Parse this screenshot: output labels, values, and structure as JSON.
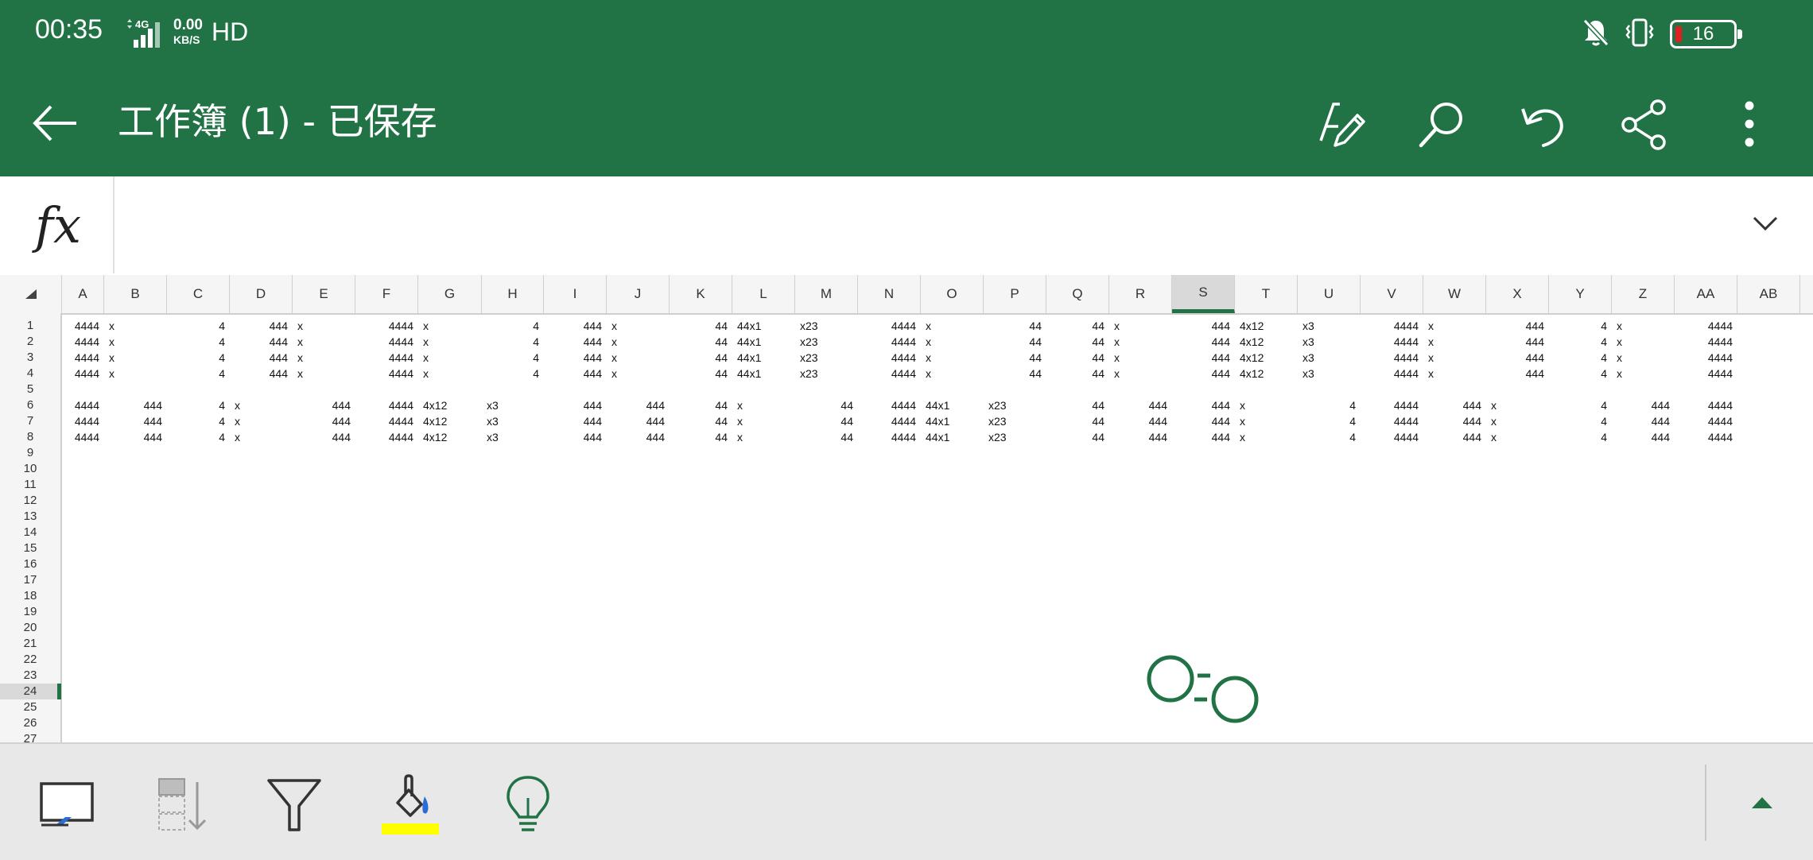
{
  "status": {
    "time": "00:35",
    "network_type": "4G",
    "speed_value": "0.00",
    "speed_unit": "KB/S",
    "hd": "HD",
    "battery": "16"
  },
  "appbar": {
    "title": "工作簿 (1) - 已保存"
  },
  "icons": {
    "back": "arrow-left-icon",
    "draw": "pen-icon",
    "search": "search-icon",
    "undo": "undo-icon",
    "share": "share-icon",
    "more": "more-vert-icon"
  },
  "formula": {
    "fx_label": "fx",
    "value": ""
  },
  "columns": [
    "A",
    "B",
    "C",
    "D",
    "E",
    "F",
    "G",
    "H",
    "I",
    "J",
    "K",
    "L",
    "M",
    "N",
    "O",
    "P",
    "Q",
    "R",
    "S",
    "T",
    "U",
    "V",
    "W",
    "X",
    "Y",
    "Z",
    "AA",
    "AB"
  ],
  "selected_column": "S",
  "rows": [
    "1",
    "2",
    "3",
    "4",
    "5",
    "6",
    "7",
    "8",
    "9",
    "10",
    "11",
    "12",
    "13",
    "14",
    "15",
    "16",
    "17",
    "18",
    "19",
    "20",
    "21",
    "22",
    "23",
    "24",
    "25",
    "26",
    "27"
  ],
  "selected_row": "24",
  "row_set_a": [
    {
      "col": "A",
      "text": "4444",
      "align": "num"
    },
    {
      "col": "A",
      "text": "x",
      "align": "tail"
    },
    {
      "col": "C",
      "text": "4",
      "align": "num"
    },
    {
      "col": "D",
      "text": "444",
      "align": "num"
    },
    {
      "col": "D",
      "text": "x",
      "align": "tail"
    },
    {
      "col": "F",
      "text": "4444",
      "align": "num"
    },
    {
      "col": "F",
      "text": "x",
      "align": "tail"
    },
    {
      "col": "H",
      "text": "4",
      "align": "num"
    },
    {
      "col": "I",
      "text": "444",
      "align": "num"
    },
    {
      "col": "I",
      "text": "x",
      "align": "tail"
    },
    {
      "col": "K",
      "text": "44",
      "align": "num"
    },
    {
      "col": "L",
      "text": "44x1",
      "align": "left"
    },
    {
      "col": "M",
      "text": "x23",
      "align": "left"
    },
    {
      "col": "N",
      "text": "4444",
      "align": "num"
    },
    {
      "col": "N",
      "text": "x",
      "align": "tail"
    },
    {
      "col": "P",
      "text": "44",
      "align": "num"
    },
    {
      "col": "Q",
      "text": "44",
      "align": "num"
    },
    {
      "col": "Q",
      "text": "x",
      "align": "tail"
    },
    {
      "col": "S",
      "text": "444",
      "align": "num"
    },
    {
      "col": "T",
      "text": "4x12",
      "align": "left"
    },
    {
      "col": "U",
      "text": "x3",
      "align": "left"
    },
    {
      "col": "V",
      "text": "4444",
      "align": "num"
    },
    {
      "col": "V",
      "text": "x",
      "align": "tail"
    },
    {
      "col": "X",
      "text": "444",
      "align": "num"
    },
    {
      "col": "Y",
      "text": "4",
      "align": "num"
    },
    {
      "col": "Y",
      "text": "x",
      "align": "tail"
    },
    {
      "col": "AA",
      "text": "4444",
      "align": "num"
    }
  ],
  "row_set_b": [
    {
      "col": "A",
      "text": "4444",
      "align": "num"
    },
    {
      "col": "B",
      "text": "444",
      "align": "num"
    },
    {
      "col": "C",
      "text": "4",
      "align": "num"
    },
    {
      "col": "C",
      "text": "x",
      "align": "tail"
    },
    {
      "col": "E",
      "text": "444",
      "align": "num"
    },
    {
      "col": "F",
      "text": "4444",
      "align": "num"
    },
    {
      "col": "G",
      "text": "4x12",
      "align": "left"
    },
    {
      "col": "H",
      "text": "x3",
      "align": "left"
    },
    {
      "col": "I",
      "text": "444",
      "align": "num"
    },
    {
      "col": "J",
      "text": "444",
      "align": "num"
    },
    {
      "col": "K",
      "text": "44",
      "align": "num"
    },
    {
      "col": "K",
      "text": "x",
      "align": "tail"
    },
    {
      "col": "M",
      "text": "44",
      "align": "num"
    },
    {
      "col": "N",
      "text": "4444",
      "align": "num"
    },
    {
      "col": "O",
      "text": "44x1",
      "align": "left"
    },
    {
      "col": "P",
      "text": "x23",
      "align": "left"
    },
    {
      "col": "Q",
      "text": "44",
      "align": "num"
    },
    {
      "col": "R",
      "text": "444",
      "align": "num"
    },
    {
      "col": "S",
      "text": "444",
      "align": "num"
    },
    {
      "col": "S",
      "text": "x",
      "align": "tail"
    },
    {
      "col": "U",
      "text": "4",
      "align": "num"
    },
    {
      "col": "V",
      "text": "4444",
      "align": "num"
    },
    {
      "col": "W",
      "text": "444",
      "align": "num"
    },
    {
      "col": "W",
      "text": "x",
      "align": "tail"
    },
    {
      "col": "Y",
      "text": "4",
      "align": "num"
    },
    {
      "col": "Z",
      "text": "444",
      "align": "num"
    },
    {
      "col": "AA",
      "text": "4444",
      "align": "num"
    }
  ],
  "row_set_a_rows": [
    "1",
    "2",
    "3",
    "4"
  ],
  "row_set_b_rows": [
    "6",
    "7",
    "8"
  ],
  "toolbar": {
    "items": [
      "select-mode-icon",
      "fill-down-icon",
      "filter-icon",
      "fill-color-icon",
      "ideas-icon"
    ],
    "highlight_color": "#ffff00"
  },
  "theme": {
    "accent": "#217346"
  }
}
